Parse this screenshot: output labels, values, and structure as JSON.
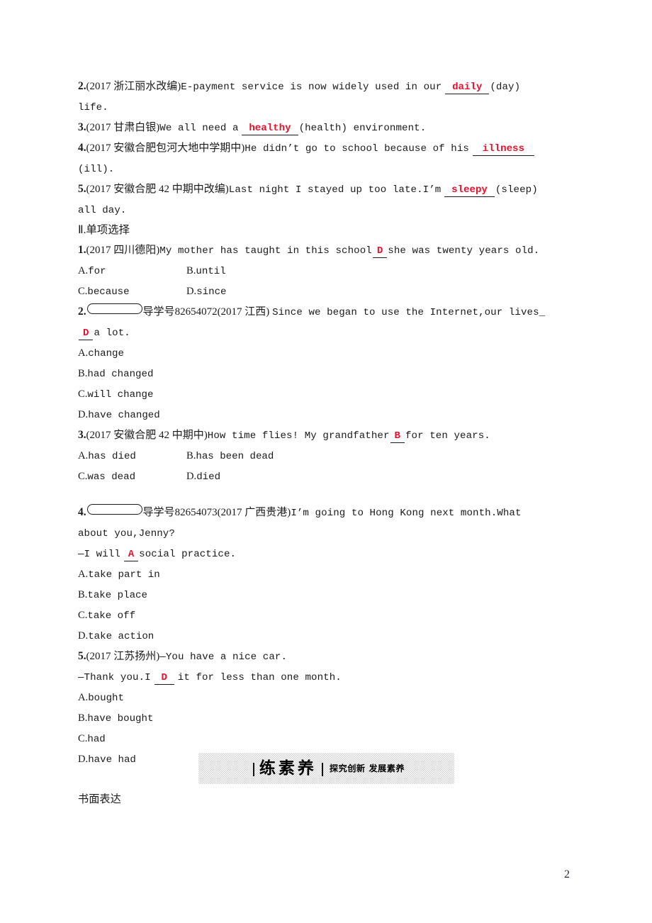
{
  "document": {
    "page_number": "2",
    "bottom_label": "书面表达"
  },
  "section_fill_in": {
    "items": [
      {
        "number": "2.",
        "source": "(2017 浙江丽水改编)",
        "text_before": "E-payment service is now widely used in our",
        "answer": "daily",
        "text_after": "(day)",
        "continuation": "life."
      },
      {
        "number": "3.",
        "source": "(2017 甘肃白银)",
        "text_before": "We all need a",
        "answer": "healthy",
        "text_after": "(health) environment.",
        "continuation": ""
      },
      {
        "number": "4.",
        "source": "(2017 安徽合肥包河大地中学期中)",
        "text_before": "He didn’t go to school because of his",
        "answer": "illness",
        "text_after": "",
        "continuation": "(ill)."
      },
      {
        "number": "5.",
        "source": "(2017 安徽合肥 42 中期中改编)",
        "text_before": "Last night I stayed up too late.I’m",
        "answer": "sleepy",
        "text_after": "(sleep)",
        "continuation": "all day."
      }
    ]
  },
  "section_multiple_choice": {
    "heading": "Ⅱ.单项选择",
    "questions": [
      {
        "number": "1.",
        "has_capsule": false,
        "guide_label": "",
        "guide_number": "",
        "source": "(2017 四川德阳)",
        "stem_before": "My mother has taught in this school",
        "answer": "D",
        "stem_after": "she was twenty years old.",
        "stem_line2": "",
        "dialog_line": "",
        "dialog_answer": "",
        "dialog_after": "",
        "layout": "two-column",
        "options": [
          {
            "label": "A.",
            "text": "for"
          },
          {
            "label": "B.",
            "text": "until"
          },
          {
            "label": "C.",
            "text": "because"
          },
          {
            "label": "D.",
            "text": "since"
          }
        ]
      },
      {
        "number": "2.",
        "has_capsule": true,
        "guide_label": "导学号",
        "guide_number": "82654072",
        "source": "(2017 江西)",
        "stem_before": "Since we began to use the Internet,our lives_",
        "answer": "D",
        "stem_after": "a lot.",
        "stem_line2": "",
        "dialog_line": "",
        "dialog_answer": "",
        "dialog_after": "",
        "layout": "stacked",
        "options": [
          {
            "label": "A.",
            "text": "change"
          },
          {
            "label": "B.",
            "text": "had changed"
          },
          {
            "label": "C.",
            "text": "will change"
          },
          {
            "label": "D.",
            "text": "have changed"
          }
        ]
      },
      {
        "number": "3.",
        "has_capsule": false,
        "guide_label": "",
        "guide_number": "",
        "source": "(2017 安徽合肥 42 中期中)",
        "stem_before": "How time flies! My grandfather",
        "answer": "B",
        "stem_after": "for ten years.",
        "stem_line2": "",
        "dialog_line": "",
        "dialog_answer": "",
        "dialog_after": "",
        "layout": "two-column",
        "options": [
          {
            "label": "A.",
            "text": "has died"
          },
          {
            "label": "B.",
            "text": "has been dead"
          },
          {
            "label": "C.",
            "text": "was dead"
          },
          {
            "label": "D.",
            "text": "died"
          }
        ]
      },
      {
        "number": "4.",
        "has_capsule": true,
        "guide_label": "导学号",
        "guide_number": "82654073",
        "source": "(2017 广西贵港)",
        "stem_before": "I’m going to Hong Kong next month.What",
        "answer": "",
        "stem_after": "",
        "stem_line2": "about you,Jenny?",
        "dialog_line": "—I will",
        "dialog_answer": "A",
        "dialog_after": "social practice.",
        "layout": "stacked",
        "options": [
          {
            "label": "A.",
            "text": "take part in"
          },
          {
            "label": "B.",
            "text": "take place"
          },
          {
            "label": "C.",
            "text": "take off"
          },
          {
            "label": "D.",
            "text": "take action"
          }
        ]
      },
      {
        "number": "5.",
        "has_capsule": false,
        "guide_label": "",
        "guide_number": "",
        "source": "(2017 江苏扬州)",
        "stem_before": "—You have a nice car.",
        "answer": "",
        "stem_after": "",
        "stem_line2": "",
        "dialog_line": "—Thank you.I",
        "dialog_answer": "D",
        "dialog_after": "it for less than one month.",
        "layout": "stacked",
        "options": [
          {
            "label": "A.",
            "text": "bought"
          },
          {
            "label": "B.",
            "text": "have bought"
          },
          {
            "label": "C.",
            "text": "had"
          },
          {
            "label": "D.",
            "text": "have had"
          }
        ]
      }
    ]
  },
  "banner": {
    "title": "练素养",
    "subtitle": "探究创新 发展素养"
  }
}
